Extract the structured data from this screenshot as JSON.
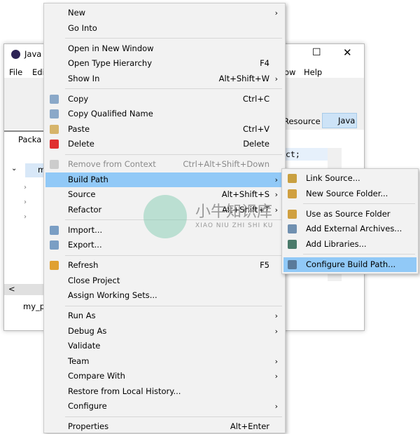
{
  "window": {
    "title": "Java -",
    "menubar": [
      "File",
      "Edi",
      "ow",
      "Help"
    ],
    "perspectives": {
      "resource": "Resource",
      "java": "Java"
    },
    "view_tab": "Packa",
    "tree_root": "m",
    "editor_text": "ct;",
    "status": "my_p"
  },
  "context_menu": {
    "items": [
      {
        "label": "New",
        "submenu": true
      },
      {
        "label": "Go Into"
      },
      {
        "sep": true
      },
      {
        "label": "Open in New Window"
      },
      {
        "label": "Open Type Hierarchy",
        "shortcut": "F4"
      },
      {
        "label": "Show In",
        "shortcut": "Alt+Shift+W",
        "submenu": true
      },
      {
        "sep": true
      },
      {
        "label": "Copy",
        "shortcut": "Ctrl+C",
        "icon": "copy-icon",
        "color": "#8aa8c8"
      },
      {
        "label": "Copy Qualified Name",
        "icon": "copy-qualified-name-icon",
        "color": "#8aa8c8"
      },
      {
        "label": "Paste",
        "shortcut": "Ctrl+V",
        "icon": "paste-icon",
        "color": "#d6b46a"
      },
      {
        "label": "Delete",
        "shortcut": "Delete",
        "icon": "delete-icon",
        "color": "#e03030"
      },
      {
        "sep": true
      },
      {
        "label": "Remove from Context",
        "shortcut": "Ctrl+Alt+Shift+Down",
        "disabled": true,
        "icon": "remove-context-icon",
        "color": "#cccccc"
      },
      {
        "label": "Build Path",
        "submenu": true,
        "highlighted": true
      },
      {
        "label": "Source",
        "shortcut": "Alt+Shift+S",
        "submenu": true
      },
      {
        "label": "Refactor",
        "shortcut": "Alt+Shift+T",
        "submenu": true
      },
      {
        "sep": true
      },
      {
        "label": "Import...",
        "icon": "import-icon",
        "color": "#7a9ec4"
      },
      {
        "label": "Export...",
        "icon": "export-icon",
        "color": "#7a9ec4"
      },
      {
        "sep": true
      },
      {
        "label": "Refresh",
        "shortcut": "F5",
        "icon": "refresh-icon",
        "color": "#e0a030"
      },
      {
        "label": "Close Project"
      },
      {
        "label": "Assign Working Sets..."
      },
      {
        "sep": true
      },
      {
        "label": "Run As",
        "submenu": true
      },
      {
        "label": "Debug As",
        "submenu": true
      },
      {
        "label": "Validate"
      },
      {
        "label": "Team",
        "submenu": true
      },
      {
        "label": "Compare With",
        "submenu": true
      },
      {
        "label": "Restore from Local History..."
      },
      {
        "label": "Configure",
        "submenu": true
      },
      {
        "sep": true
      },
      {
        "label": "Properties",
        "shortcut": "Alt+Enter"
      }
    ]
  },
  "build_path_submenu": {
    "items": [
      {
        "label": "Link Source...",
        "icon": "link-source-icon",
        "color": "#c9a040"
      },
      {
        "label": "New Source Folder...",
        "icon": "new-source-folder-icon",
        "color": "#d0a040"
      },
      {
        "sep": true
      },
      {
        "label": "Use as Source Folder",
        "icon": "use-source-folder-icon",
        "color": "#d0a040"
      },
      {
        "label": "Add External Archives...",
        "icon": "add-archives-icon",
        "color": "#7090b0"
      },
      {
        "label": "Add Libraries...",
        "icon": "add-libraries-icon",
        "color": "#4a7a6a"
      },
      {
        "sep": true
      },
      {
        "label": "Configure Build Path...",
        "icon": "configure-build-path-icon",
        "color": "#5a7a9a",
        "highlighted": true
      }
    ]
  },
  "watermark": {
    "text": "小牛知识库",
    "sub": "XIAO NIU ZHI SHI KU"
  },
  "colors": {
    "highlight": "#91c9f7",
    "menu_bg": "#f2f2f2"
  }
}
